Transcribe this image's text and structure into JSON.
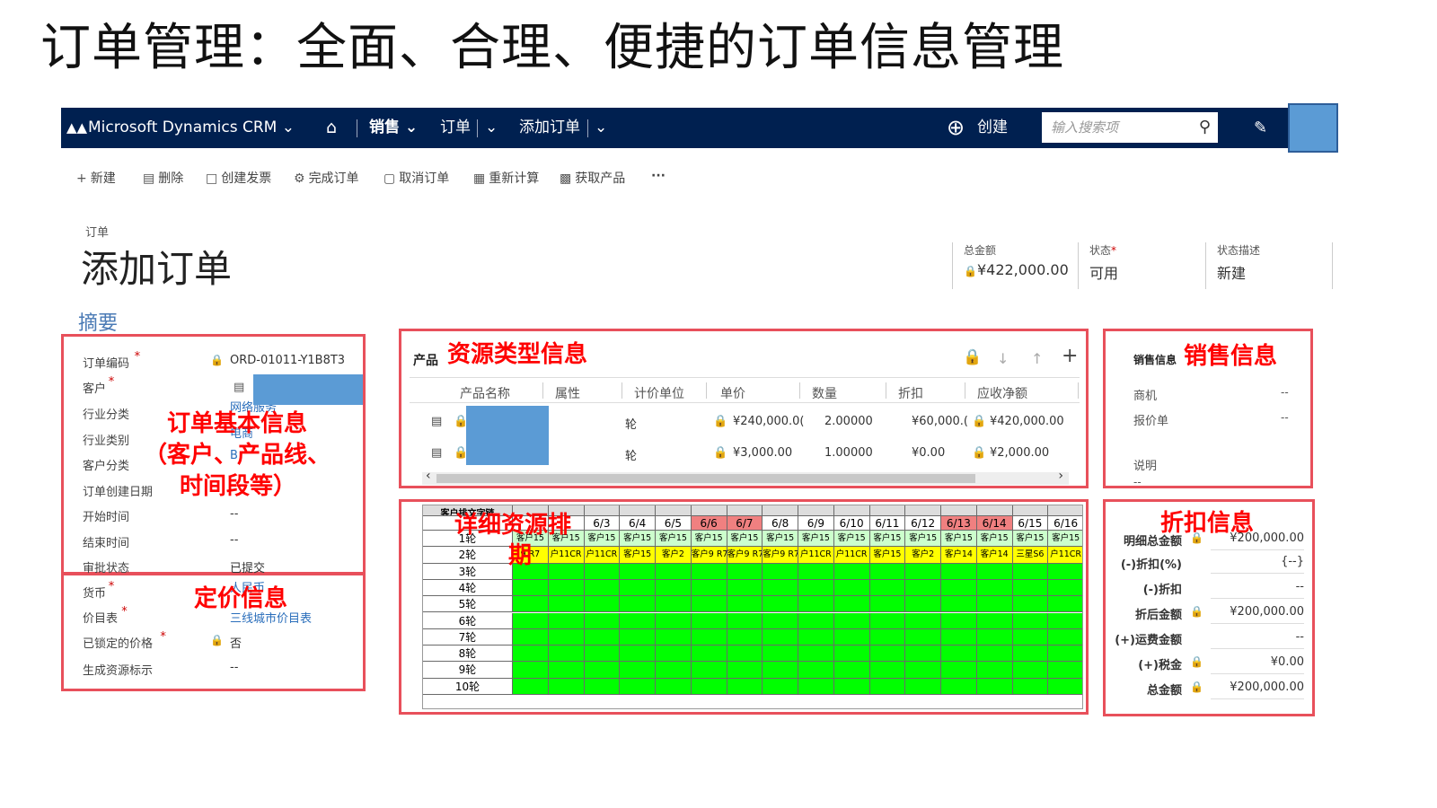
{
  "slide_title": "订单管理：全面、合理、便捷的订单信息管理",
  "nav": {
    "brand": "Microsoft Dynamics CRM",
    "home_icon": "home-icon",
    "sales": "销售",
    "orders": "订单",
    "add_order": "添加订单",
    "create": "创建",
    "search_placeholder": "输入搜索项"
  },
  "toolbar": {
    "new": "新建",
    "delete": "删除",
    "create_invoice": "创建发票",
    "complete_order": "完成订单",
    "cancel_order": "取消订单",
    "recalculate": "重新计算",
    "get_products": "获取产品",
    "more": "···"
  },
  "record": {
    "entity_type": "订单",
    "title": "添加订单"
  },
  "kpis": [
    {
      "label": "总金额",
      "value": "¥422,000.00",
      "required": false
    },
    {
      "label": "状态",
      "value": "可用",
      "required": true
    },
    {
      "label": "状态描述",
      "value": "新建",
      "required": false
    }
  ],
  "summary_title": "摘要",
  "order_fields": [
    {
      "label": "订单编码",
      "required": true,
      "value": "ORD-01011-Y1B8T3",
      "locked": true
    },
    {
      "label": "客户",
      "required": true,
      "value": "",
      "locked": false
    },
    {
      "label": "行业分类",
      "required": false,
      "value": "网络服务",
      "link": true
    },
    {
      "label": "行业类别",
      "required": false,
      "value": "电商",
      "link": true
    },
    {
      "label": "客户分类",
      "required": false,
      "value": "B",
      "link": true
    },
    {
      "label": "订单创建日期",
      "required": false,
      "value": ""
    },
    {
      "label": "开始时间",
      "required": false,
      "value": "--"
    },
    {
      "label": "结束时间",
      "required": false,
      "value": "--"
    },
    {
      "label": "审批状态",
      "required": false,
      "value": "已提交"
    }
  ],
  "pricing_fields": [
    {
      "label": "货币",
      "required": true,
      "value": "人民币",
      "link": true
    },
    {
      "label": "价目表",
      "required": true,
      "value": "三线城市价目表",
      "link": true
    },
    {
      "label": "已锁定的价格",
      "required": true,
      "value": "否",
      "locked": true
    },
    {
      "label": "生成资源标示",
      "required": false,
      "value": "--"
    }
  ],
  "annotations": {
    "order_basic": "订单基本信息",
    "order_basic_sub1": "（客户、产品线、",
    "order_basic_sub2": "时间段等）",
    "pricing": "定价信息",
    "resource_type": "资源类型信息",
    "schedule": "详细资源排",
    "schedule2": "期",
    "sales": "销售信息",
    "discount": "折扣信息"
  },
  "products": {
    "label": "产品",
    "columns": [
      "产品名称",
      "属性",
      "计价单位",
      "单价",
      "数量",
      "折扣",
      "应收净额"
    ],
    "rows": [
      {
        "unit": "轮",
        "price": "¥240,000.0(",
        "qty": "2.00000",
        "discount": "¥60,000.(",
        "net": "¥420,000.00"
      },
      {
        "unit": "轮",
        "price": "¥3,000.00",
        "qty": "1.00000",
        "discount": "¥0.00",
        "net": "¥2,000.00"
      }
    ]
  },
  "schedule": {
    "corner": "客户排文字链",
    "dates": [
      "6/3",
      "6/4",
      "6/5",
      "6/6",
      "6/7",
      "6/8",
      "6/9",
      "6/10",
      "6/11",
      "6/12",
      "6/13",
      "6/14",
      "6/15",
      "6/16"
    ],
    "highlight_dates": [
      "6/6",
      "6/7",
      "6/13",
      "6/14"
    ],
    "rounds": [
      "1轮",
      "2轮",
      "3轮",
      "4轮",
      "5轮",
      "6轮",
      "7轮",
      "8轮",
      "9轮",
      "10轮"
    ],
    "row1": [
      "客户15",
      "客户15",
      "客户15",
      "客户15",
      "客户15",
      "客户15",
      "客户15",
      "客户15",
      "客户15",
      "客户15",
      "客户15",
      "客户15",
      "客户15",
      "客户15",
      "客户15",
      "客户15"
    ],
    "row2": [
      "9 R7",
      "户11CR",
      "户11CR",
      "客户15",
      "客户2",
      "客户9 R7",
      "客户9 R7",
      "客户9 R7",
      "户11CR",
      "户11CR",
      "客户15",
      "客户2",
      "客户14",
      "客户14",
      "三星S6",
      "户11CR"
    ],
    "colors": {
      "date_header": "#ffffff",
      "date_highlight": "#f08080",
      "row1": "#ccffcc",
      "row2": "#ffff00",
      "free": "#00ff00"
    }
  },
  "sales_info": {
    "header": "销售信息",
    "fields": [
      {
        "label": "商机",
        "value": "--"
      },
      {
        "label": "报价单",
        "value": "--"
      },
      {
        "label": "说明",
        "value": "--"
      }
    ]
  },
  "discount_info": {
    "fields": [
      {
        "label": "明细总金额",
        "value": "¥200,000.00",
        "locked": true
      },
      {
        "label": "(-)折扣(%)",
        "value": "{--}",
        "locked": false
      },
      {
        "label": "(-)折扣",
        "value": "--",
        "locked": false
      },
      {
        "label": "折后金额",
        "value": "¥200,000.00",
        "locked": true
      },
      {
        "label": "(+)运费金额",
        "value": "--",
        "locked": false
      },
      {
        "label": "(+)税金",
        "value": "¥0.00",
        "locked": true
      },
      {
        "label": "总金额",
        "value": "¥200,000.00",
        "locked": true
      }
    ]
  },
  "colors": {
    "nav_bg": "#002050",
    "highlight_blue": "#5b9bd5",
    "annotation_red": "#ff0000",
    "box_red": "#e8505b"
  }
}
